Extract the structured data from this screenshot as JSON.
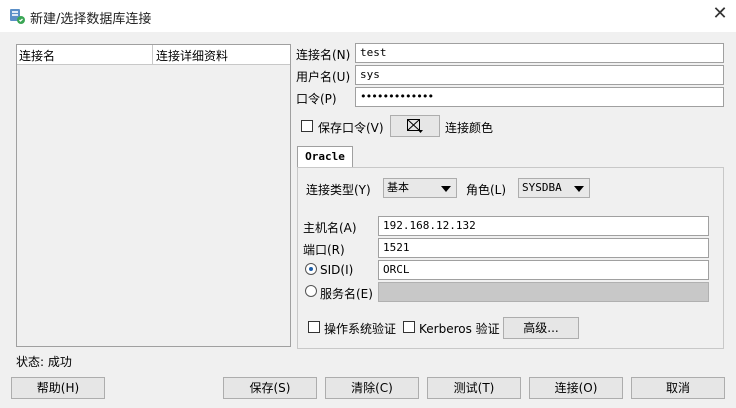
{
  "window": {
    "title": "新建/选择数据库连接",
    "close_glyph": "✕"
  },
  "connections_table": {
    "headers": [
      "连接名",
      "连接详细资料"
    ]
  },
  "form": {
    "conn_name_label": "连接名(N)",
    "conn_name_value": "test",
    "username_label": "用户名(U)",
    "username_value": "sys",
    "password_label": "口令(P)",
    "password_value": "•••••••••••••",
    "save_password_label": "保存口令(V)",
    "save_password_checked": false,
    "conn_color_label": "连接颜色"
  },
  "tabs": [
    {
      "label": "Oracle",
      "active": true
    }
  ],
  "oracle": {
    "conn_type_label": "连接类型(Y)",
    "conn_type_value": "基本",
    "role_label": "角色(L)",
    "role_value": "SYSDBA",
    "host_label": "主机名(A)",
    "host_value": "192.168.12.132",
    "port_label": "端口(R)",
    "port_value": "1521",
    "sid_label": "SID(I)",
    "sid_value": "ORCL",
    "sid_selected": true,
    "service_label": "服务名(E)",
    "service_value": "",
    "os_auth_label": "操作系统验证",
    "kerberos_label": "Kerberos 验证",
    "advanced_label": "高级..."
  },
  "status": {
    "text": "状态: 成功"
  },
  "buttons": {
    "help": "帮助(H)",
    "save": "保存(S)",
    "clear": "清除(C)",
    "test": "测试(T)",
    "connect": "连接(O)",
    "cancel": "取消"
  },
  "colors": {
    "accent": "#1f5fa8",
    "panel_bg": "#f0f0f0",
    "button_bg": "#e6e6e6"
  }
}
